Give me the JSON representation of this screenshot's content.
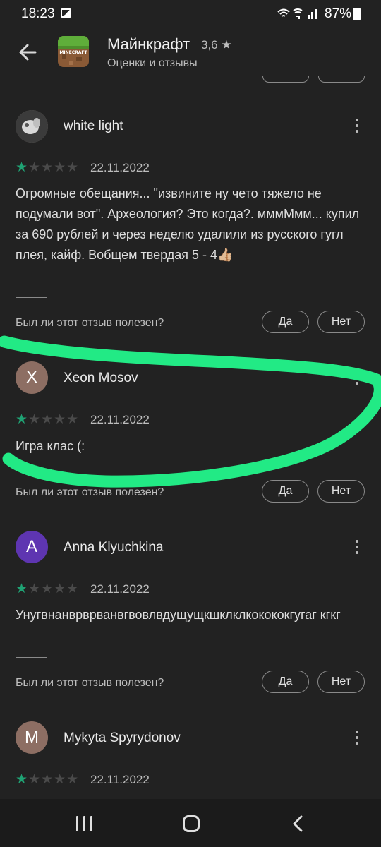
{
  "status_bar": {
    "time": "18:23",
    "battery_percent": "87%",
    "icons": [
      "gallery-icon",
      "wifi-icon",
      "wifi-calling-icon",
      "signal-icon",
      "battery-icon"
    ]
  },
  "header": {
    "title": "Майнкрафт",
    "rating": "3,6",
    "subtitle": "Оценки и отзывы",
    "app_icon_text": "MINECRAFT"
  },
  "reviews": [
    {
      "author": "white light",
      "avatar_letter": "",
      "avatar_color": "#6f6a66",
      "stars_filled": 1,
      "date": "22.11.2022",
      "text": "Огромные обещания... \"извините ну чето тяжело не подумали вот\". Археология? Это когда?. мммМмм... купил за 690 рублей и через неделю удалили из русского гугл плея, кайф. Вобщем твердая 5 - 4👍🏼",
      "helpful_question": "Был ли этот отзыв полезен?",
      "yes_label": "Да",
      "no_label": "Нет"
    },
    {
      "author": "Xeon Mosov",
      "avatar_letter": "X",
      "avatar_color": "#8d6e63",
      "stars_filled": 1,
      "date": "22.11.2022",
      "text": "Игра клас (:",
      "helpful_question": "Был ли этот отзыв полезен?",
      "yes_label": "Да",
      "no_label": "Нет"
    },
    {
      "author": "Anna Klyuchkina",
      "avatar_letter": "A",
      "avatar_color": "#5e35b1",
      "stars_filled": 1,
      "date": "22.11.2022",
      "text": "Унугвнанврврванвгвовлвдущущкшклклкокококгугаг кгкг",
      "helpful_question": "Был ли этот отзыв полезен?",
      "yes_label": "Да",
      "no_label": "Нет"
    },
    {
      "author": "Mykyta Spyrydonov",
      "avatar_letter": "M",
      "avatar_color": "#8d6e63",
      "stars_filled": 1,
      "date": "22.11.2022"
    }
  ],
  "colors": {
    "background": "#222222",
    "star_filled": "#1fa374",
    "star_empty": "#4a4a4a",
    "annotation_marker": "#22ea85"
  },
  "nav_bar": {
    "icons": [
      "recents-icon",
      "home-icon",
      "back-icon"
    ]
  }
}
